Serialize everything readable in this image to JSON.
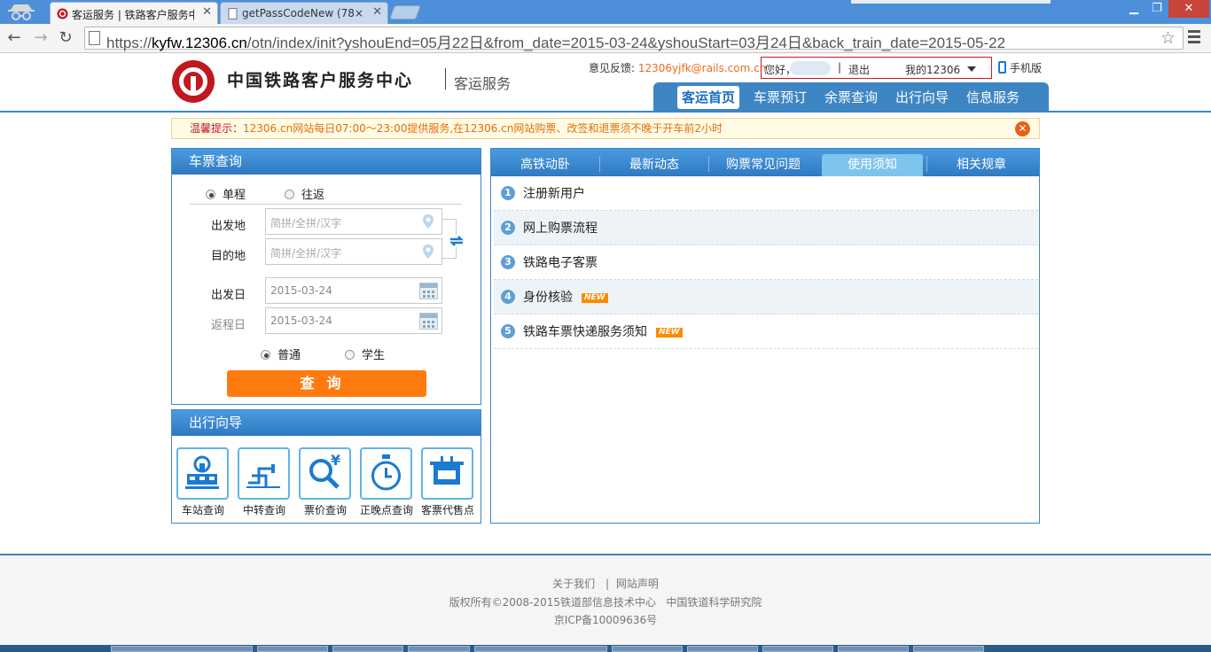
{
  "browser": {
    "tabs": [
      {
        "label": "客运服务 | 铁路客户服务中",
        "active": true
      },
      {
        "label": "getPassCodeNew (78×2",
        "active": false
      }
    ],
    "url_prefix": "https://",
    "url_host": "kyfw.12306.cn",
    "url_path": "/otn/index/init?yshouEnd=05月22日&from_date=2015-03-24&yshouStart=03月24日&back_train_date=2015-05-22"
  },
  "header": {
    "site_title": "中国铁路客户服务中心",
    "site_subtitle": "客运服务",
    "feedback_label": "意见反馈:",
    "feedback_email": "12306yjfk@rails.com.cn",
    "greeting": "您好，",
    "separator": "|",
    "logout": "退出",
    "my12306": "我的12306",
    "mobile": "手机版",
    "nav": [
      "客运首页",
      "车票预订",
      "余票查询",
      "出行向导",
      "信息服务"
    ]
  },
  "notice": {
    "label": "温馨提示：",
    "text": "12306.cn网站每日07:00～23:00提供服务,在12306.cn网站购票、改签和退票须不晚于开车前2小时"
  },
  "ticket_query": {
    "title": "车票查询",
    "trip_types": [
      "单程",
      "往返"
    ],
    "selected_trip": "单程",
    "from_label": "出发地",
    "to_label": "目的地",
    "station_placeholder": "简拼/全拼/汉字",
    "depart_label": "出发日",
    "return_label": "返程日",
    "depart_date": "2015-03-24",
    "return_date": "2015-03-24",
    "passenger_types": [
      "普通",
      "学生"
    ],
    "selected_passenger": "普通",
    "search_button": "查询"
  },
  "travel_guide": {
    "title": "出行向导",
    "items": [
      "车站查询",
      "中转查询",
      "票价查询",
      "正晚点查询",
      "客票代售点"
    ]
  },
  "info": {
    "tabs": [
      "高铁动卧",
      "最新动态",
      "购票常见问题",
      "使用须知",
      "相关规章"
    ],
    "active_tab": "使用须知",
    "items": [
      {
        "num": "1",
        "text": "注册新用户",
        "new": false
      },
      {
        "num": "2",
        "text": "网上购票流程",
        "new": false
      },
      {
        "num": "3",
        "text": "铁路电子客票",
        "new": false
      },
      {
        "num": "4",
        "text": "身份核验",
        "new": true
      },
      {
        "num": "5",
        "text": "铁路车票快递服务须知",
        "new": true
      }
    ],
    "new_badge": "NEW"
  },
  "footer": {
    "links": [
      "关于我们",
      "网站声明"
    ],
    "link_sep": "|",
    "copyright": "版权所有©2008-2015铁道部信息技术中心   中国铁道科学研究院",
    "icp": "京ICP备10009636号"
  },
  "colors": {
    "brand_blue": "#3e86c3",
    "brand_red": "#c0181e",
    "accent_orange": "#ff7b0f"
  }
}
